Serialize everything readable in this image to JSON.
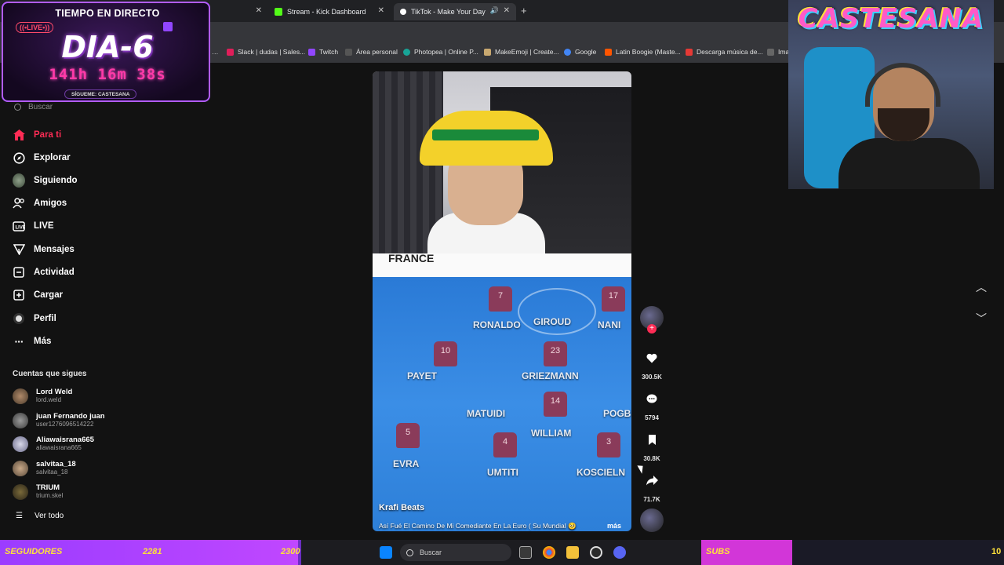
{
  "browser": {
    "tabs": [
      {
        "label": "",
        "active": false
      },
      {
        "label": "Stream - Kick Dashboard",
        "active": false
      },
      {
        "label": "TikTok - Make Your Day",
        "active": true
      }
    ],
    "bookmarks": [
      "Slack | dudas | Sales...",
      "Twitch",
      "Área personal",
      "Photopea | Online P...",
      "MakeEmoji | Create...",
      "Google",
      "Latin Boogie (Maste...",
      "Descarga música de...",
      "Ima"
    ]
  },
  "sidebar": {
    "search_placeholder": "Buscar",
    "nav": [
      {
        "label": "Para ti",
        "icon": "home-icon",
        "active": true
      },
      {
        "label": "Explorar",
        "icon": "compass-icon",
        "active": false
      },
      {
        "label": "Siguiendo",
        "icon": "following-avatar-icon",
        "active": false
      },
      {
        "label": "Amigos",
        "icon": "friends-icon",
        "active": false
      },
      {
        "label": "LIVE",
        "icon": "live-icon",
        "active": false
      },
      {
        "label": "Mensajes",
        "icon": "messages-icon",
        "active": false
      },
      {
        "label": "Actividad",
        "icon": "activity-icon",
        "active": false
      },
      {
        "label": "Cargar",
        "icon": "upload-icon",
        "active": false
      },
      {
        "label": "Perfil",
        "icon": "profile-icon",
        "active": false
      },
      {
        "label": "Más",
        "icon": "more-icon",
        "active": false
      }
    ],
    "following_heading": "Cuentas que sigues",
    "accounts": [
      {
        "name": "Lord Weld",
        "handle": "lord.weld"
      },
      {
        "name": "juan Fernando juan",
        "handle": "user1276096514222"
      },
      {
        "name": "Aliawaisrana665",
        "handle": "aliawaisrana665"
      },
      {
        "name": "salvitaa_18",
        "handle": "salvitaa_18"
      },
      {
        "name": "TRIUM",
        "handle": "trium.skel"
      }
    ],
    "see_all": "Ver todo"
  },
  "video": {
    "banner_text": "FRANCE",
    "author": "Krafi Beats",
    "description": "Así Fué El Camino De Mi Comediante En La Euro ( Su Mundial 🥺",
    "more": "más",
    "players": [
      {
        "name": "RONALDO",
        "number": "7"
      },
      {
        "name": "GIROUD",
        "number": ""
      },
      {
        "name": "NANI",
        "number": "17"
      },
      {
        "name": "PAYET",
        "number": "10"
      },
      {
        "name": "GRIEZMANN",
        "number": "23"
      },
      {
        "name": "MATUIDI",
        "number": ""
      },
      {
        "name": "WILLIAM",
        "number": "14"
      },
      {
        "name": "POGB",
        "number": ""
      },
      {
        "name": "EVRA",
        "number": "5"
      },
      {
        "name": "UMTITI",
        "number": "4"
      },
      {
        "name": "KOSCIELN",
        "number": "3"
      }
    ]
  },
  "actions": {
    "likes": "300.5K",
    "comments": "5794",
    "saves": "30.8K",
    "shares": "71.7K"
  },
  "overlay": {
    "live_title": "TIEMPO EN DIRECTO",
    "live_badge": "((•LIVE•))",
    "day": "DIA-6",
    "timer": "141h 16m 38s",
    "follow_me": "SÍGUEME: CASTESANA",
    "cam_logo": "CASTESANA"
  },
  "bottom": {
    "followers_label": "SEGUIDORES",
    "followers_current": "2281",
    "followers_target": "2300",
    "followers_progress": 0.99,
    "subs_label": "SUBS",
    "subs_current": "",
    "subs_target": "10",
    "subs_progress": 0.3,
    "taskbar_search": "Buscar"
  },
  "colors": {
    "accent": "#fe2c55",
    "panel": "#121212"
  }
}
